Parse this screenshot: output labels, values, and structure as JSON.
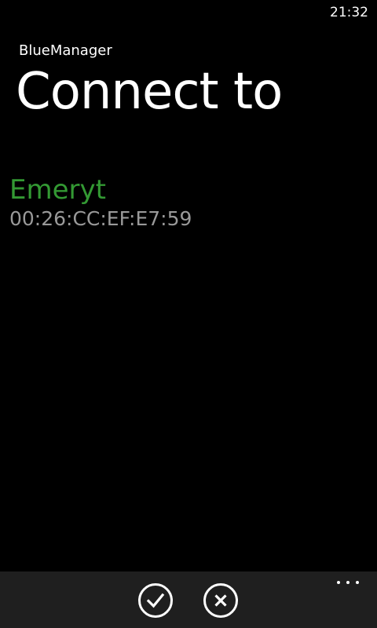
{
  "status_bar": {
    "time": "21:32"
  },
  "header": {
    "app_name": "BlueManager",
    "page_title": "Connect to"
  },
  "devices": [
    {
      "name": "Emeryt",
      "address": "00:26:CC:EF:E7:59"
    }
  ],
  "app_bar": {
    "buttons": [
      {
        "icon": "check-icon"
      },
      {
        "icon": "close-icon"
      }
    ],
    "more_icon": "ellipsis-icon"
  },
  "colors": {
    "background": "#000000",
    "accent": "#339933",
    "secondary_text": "#999999",
    "app_bar": "#1f1f1f"
  }
}
